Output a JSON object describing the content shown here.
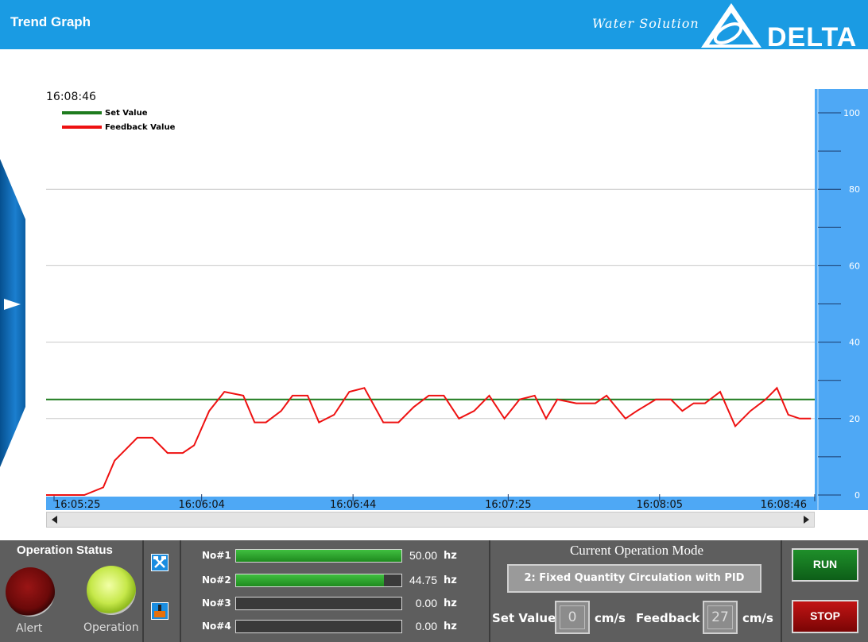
{
  "header": {
    "title": "Trend Graph",
    "tagline": "Water Solution",
    "brand": "DELTA"
  },
  "chart": {
    "current_time": "16:08:46"
  },
  "chart_data": {
    "type": "line",
    "ylim": [
      0,
      100
    ],
    "yticks": [
      0,
      20,
      40,
      60,
      80,
      100
    ],
    "xtick_labels": [
      "16:05:25",
      "16:06:04",
      "16:06:44",
      "16:07:25",
      "16:08:05",
      "16:08:46"
    ],
    "grid": true,
    "legend_position": "top-left",
    "series": [
      {
        "name": "Set Value",
        "color": "#1e7b1e",
        "x": [
          "16:05:25",
          "16:08:46"
        ],
        "y": [
          25,
          25
        ]
      },
      {
        "name": "Feedback Value",
        "color": "#ee1111",
        "x": [
          "16:05:25",
          "16:05:27",
          "16:05:33",
          "16:05:38",
          "16:05:41",
          "16:05:44",
          "16:05:47",
          "16:05:51",
          "16:05:55",
          "16:05:59",
          "16:06:02",
          "16:06:06",
          "16:06:10",
          "16:06:15",
          "16:06:18",
          "16:06:21",
          "16:06:25",
          "16:06:28",
          "16:06:32",
          "16:06:35",
          "16:06:39",
          "16:06:43",
          "16:06:47",
          "16:06:52",
          "16:06:56",
          "16:07:00",
          "16:07:04",
          "16:07:08",
          "16:07:12",
          "16:07:16",
          "16:07:20",
          "16:07:24",
          "16:07:28",
          "16:07:32",
          "16:07:35",
          "16:07:38",
          "16:07:43",
          "16:07:48",
          "16:07:51",
          "16:07:56",
          "16:07:59",
          "16:08:04",
          "16:08:08",
          "16:08:11",
          "16:08:14",
          "16:08:17",
          "16:08:21",
          "16:08:25",
          "16:08:29",
          "16:08:33",
          "16:08:36",
          "16:08:39",
          "16:08:42",
          "16:08:45"
        ],
        "y": [
          0,
          0,
          0,
          2,
          9,
          12,
          15,
          15,
          11,
          11,
          13,
          22,
          27,
          26,
          19,
          19,
          22,
          26,
          26,
          19,
          21,
          27,
          28,
          19,
          19,
          23,
          26,
          26,
          20,
          22,
          26,
          20,
          25,
          26,
          20,
          25,
          24,
          24,
          26,
          20,
          22,
          25,
          25,
          22,
          24,
          24,
          27,
          18,
          22,
          25,
          28,
          21,
          20,
          20
        ]
      }
    ]
  },
  "status": {
    "title": "Operation Status",
    "alert_label": "Alert",
    "operation_label": "Operation"
  },
  "motors": [
    {
      "label": "No#1",
      "value": "50.00",
      "unit": "hz",
      "level": 1.0
    },
    {
      "label": "No#2",
      "value": "44.75",
      "unit": "hz",
      "level": 0.895
    },
    {
      "label": "No#3",
      "value": "0.00",
      "unit": "hz",
      "level": 0
    },
    {
      "label": "No#4",
      "value": "0.00",
      "unit": "hz",
      "level": 0
    }
  ],
  "mode": {
    "title": "Current Operation Mode",
    "current": "2: Fixed Quantity Circulation with PID",
    "set_value_label": "Set Value",
    "set_value": "0",
    "set_unit": "cm/s",
    "feedback_label": "Feedback",
    "feedback_value": "27",
    "feedback_unit": "cm/s"
  },
  "buttons": {
    "run": "RUN",
    "stop": "STOP"
  },
  "colors": {
    "header": "#1a9be3",
    "axis_panel": "#4ea8f5",
    "set_value_line": "#1e7b1e",
    "feedback_line": "#ee1111",
    "alert_lamp": "#8a1010",
    "operation_lamp": "#c6e84a"
  }
}
